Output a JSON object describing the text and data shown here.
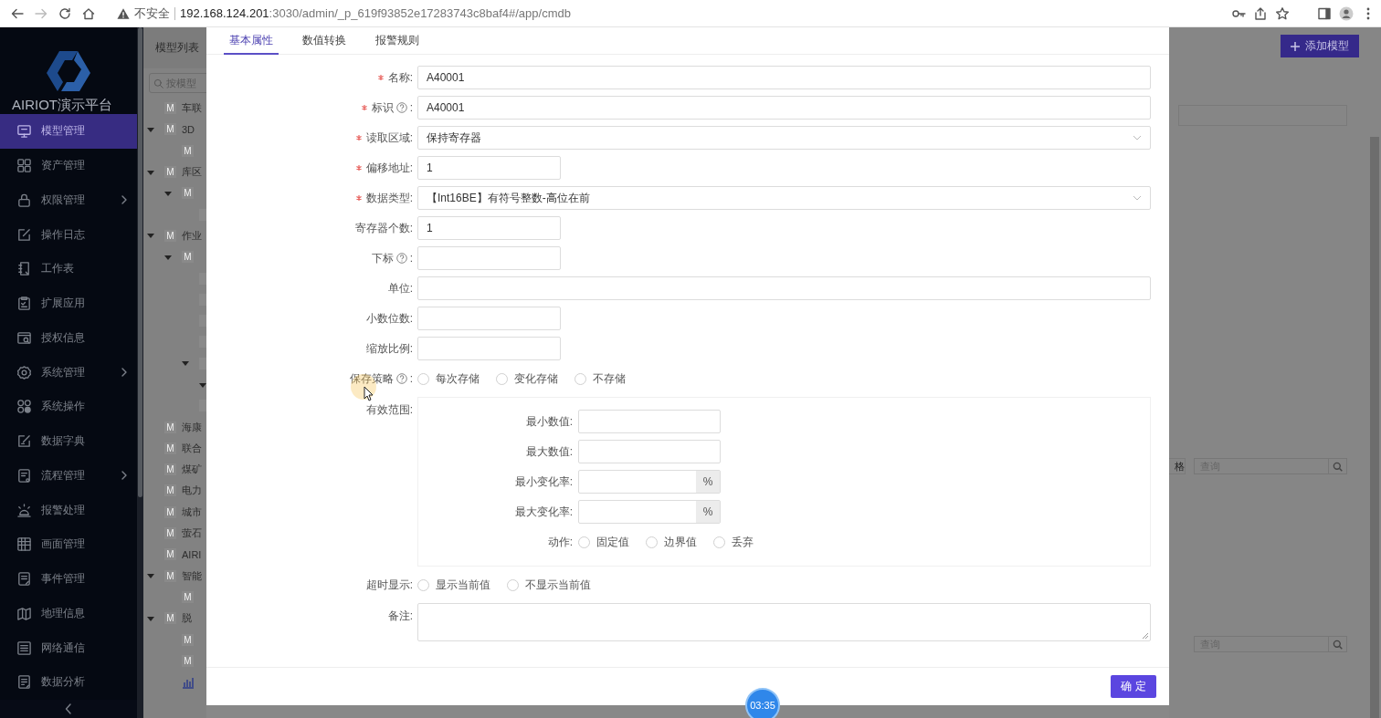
{
  "browser": {
    "forward_disabled": true,
    "security": "不安全",
    "url_host": "192.168.124.201",
    "url_path": ":3030/admin/_p_619f93852e17283743c8baf4#/app/cmdb"
  },
  "sidebar": {
    "brand": "AIRIOT演示平台",
    "items": [
      {
        "label": "模型管理",
        "selected": true
      },
      {
        "label": "资产管理",
        "selected": false
      },
      {
        "label": "权限管理",
        "selected": false,
        "submenu": true
      },
      {
        "label": "操作日志",
        "selected": false
      },
      {
        "label": "工作表",
        "selected": false
      },
      {
        "label": "扩展应用",
        "selected": false
      },
      {
        "label": "授权信息",
        "selected": false
      },
      {
        "label": "系统管理",
        "selected": false,
        "submenu": true
      },
      {
        "label": "系统操作",
        "selected": false
      },
      {
        "label": "数据字典",
        "selected": false
      },
      {
        "label": "流程管理",
        "selected": false,
        "submenu": true
      },
      {
        "label": "报警处理",
        "selected": false
      },
      {
        "label": "画面管理",
        "selected": false
      },
      {
        "label": "事件管理",
        "selected": false
      },
      {
        "label": "地理信息",
        "selected": false
      },
      {
        "label": "网络通信",
        "selected": false
      },
      {
        "label": "数据分析",
        "selected": false
      }
    ]
  },
  "tree": {
    "title": "模型列表",
    "search_placeholder": "按模型",
    "items": [
      {
        "kind": "model",
        "badge": "M",
        "label": "车联"
      },
      {
        "kind": "model",
        "badge": "M",
        "label": "3D",
        "expanded": true,
        "children": [
          {
            "kind": "model",
            "badge": "M"
          }
        ]
      },
      {
        "kind": "model",
        "badge": "M",
        "label": "库区",
        "expanded": true,
        "children": [
          {
            "kind": "model",
            "badge": "M",
            "expanded": true,
            "children": [
              {
                "kind": "model"
              }
            ]
          }
        ]
      },
      {
        "kind": "model",
        "badge": "M",
        "label": "作业",
        "expanded": true,
        "children": [
          {
            "kind": "model",
            "badge": "M",
            "expanded": true,
            "children": [
              {
                "kind": "model"
              },
              {
                "kind": "model"
              },
              {
                "kind": "model"
              },
              {
                "kind": "model"
              },
              {
                "kind": "model",
                "expanded": true,
                "children": [
                  {
                    "expanded": true
                  }
                ]
              },
              {
                "kind": "model"
              }
            ]
          }
        ]
      },
      {
        "kind": "model",
        "badge": "M",
        "label": "海康"
      },
      {
        "kind": "model",
        "badge": "M",
        "label": "联合"
      },
      {
        "kind": "model",
        "badge": "M",
        "label": "煤矿"
      },
      {
        "kind": "model",
        "badge": "M",
        "label": "电力"
      },
      {
        "kind": "model",
        "badge": "M",
        "label": "城市"
      },
      {
        "kind": "model",
        "badge": "M",
        "label": "萤石"
      },
      {
        "kind": "model",
        "badge": "M",
        "label": "AIRI"
      },
      {
        "kind": "model",
        "badge": "M",
        "label": "智能",
        "expanded": true,
        "children": [
          {
            "kind": "model",
            "badge": "M"
          }
        ]
      },
      {
        "kind": "model",
        "badge": "M",
        "label": "脱",
        "expanded": true,
        "children": [
          {
            "kind": "model",
            "badge": "M"
          },
          {
            "kind": "model",
            "badge": "M"
          },
          {
            "kind": "chart"
          }
        ]
      }
    ]
  },
  "modal": {
    "tabs": [
      {
        "label": "基本属性",
        "selected": true
      },
      {
        "label": "数值转换",
        "selected": false
      },
      {
        "label": "报警规则",
        "selected": false
      }
    ],
    "fields": [
      {
        "kind": "text",
        "label": "名称:",
        "required": true,
        "value": "A40001"
      },
      {
        "kind": "text",
        "label": "标识",
        "help": true,
        "label_tail": ":",
        "required": true,
        "value": "A40001"
      },
      {
        "kind": "select",
        "label": "读取区域:",
        "required": true,
        "value": "保持寄存器"
      },
      {
        "kind": "number",
        "label": "偏移地址:",
        "required": true,
        "value": "1"
      },
      {
        "kind": "select",
        "label": "数据类型:",
        "required": true,
        "value": "【Int16BE】有符号整数-高位在前"
      },
      {
        "kind": "number",
        "label": "寄存器个数:",
        "required": false,
        "value": "1"
      },
      {
        "kind": "number",
        "label": "下标",
        "help": true,
        "label_tail": ":",
        "required": false
      },
      {
        "kind": "text",
        "label": "单位:",
        "required": false
      },
      {
        "kind": "number",
        "label": "小数位数:",
        "required": false
      },
      {
        "kind": "number",
        "label": "缩放比例:",
        "required": false
      },
      {
        "kind": "radio",
        "label": "保存策略",
        "help": true,
        "label_tail": ":",
        "options": [
          {
            "label": "每次存储",
            "selected": false
          },
          {
            "label": "变化存储",
            "selected": false
          },
          {
            "label": "不存储",
            "selected": false
          }
        ]
      },
      {
        "kind": "range",
        "label": "有效范围:",
        "fields": [
          {
            "kind": "number",
            "label": "最小数值:"
          },
          {
            "kind": "number",
            "label": "最大数值:"
          },
          {
            "kind": "percent",
            "label": "最小变化率:",
            "suffix": "%"
          },
          {
            "kind": "percent",
            "label": "最大变化率:",
            "suffix": "%"
          },
          {
            "kind": "radio",
            "label": "动作:",
            "options": [
              {
                "label": "固定值",
                "selected": false
              },
              {
                "label": "边界值",
                "selected": false
              },
              {
                "label": "丢弃",
                "selected": false
              }
            ]
          }
        ]
      },
      {
        "kind": "radio",
        "label": "超时显示:",
        "options": [
          {
            "label": "显示当前值",
            "selected": false
          },
          {
            "label": "不显示当前值",
            "selected": false
          }
        ]
      },
      {
        "kind": "textarea",
        "label": "备注:"
      }
    ],
    "confirm": "确 定"
  },
  "right": {
    "add_button": "添加模型",
    "fragment": "格",
    "search_fields": [
      {
        "placeholder": "查询"
      },
      {
        "placeholder": "查询"
      }
    ]
  },
  "timer": "03:35"
}
